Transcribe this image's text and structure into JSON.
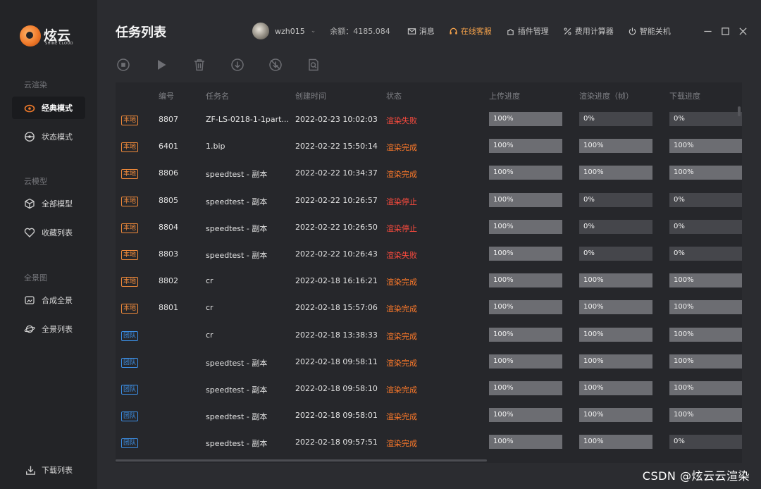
{
  "app": {
    "logo_text": "炫云",
    "logo_sub": "SHINE CLOUD"
  },
  "sidebar": {
    "groups": [
      {
        "label": "云渲染",
        "items": [
          {
            "label": "经典模式",
            "icon": "cloud-icon",
            "active": true
          },
          {
            "label": "状态模式",
            "icon": "gauge-icon",
            "active": false
          }
        ]
      },
      {
        "label": "云模型",
        "items": [
          {
            "label": "全部模型",
            "icon": "cube-icon",
            "active": false
          },
          {
            "label": "收藏列表",
            "icon": "heart-icon",
            "active": false
          }
        ]
      },
      {
        "label": "全景图",
        "items": [
          {
            "label": "合成全景",
            "icon": "panorama-icon",
            "active": false
          },
          {
            "label": "全景列表",
            "icon": "planet-icon",
            "active": false
          }
        ]
      }
    ],
    "download_label": "下载列表"
  },
  "header": {
    "title": "任务列表",
    "username": "wzh015",
    "balance": "余额：4185.084",
    "actions": [
      {
        "label": "消息",
        "icon": "mail-icon"
      },
      {
        "label": "在线客服",
        "icon": "headset-icon"
      },
      {
        "label": "插件管理",
        "icon": "plugin-icon"
      },
      {
        "label": "费用计算器",
        "icon": "percent-icon"
      },
      {
        "label": "智能关机",
        "icon": "power-icon"
      }
    ],
    "accent_color": "#f7a34b"
  },
  "toolbar": {
    "tools": [
      "stop-icon",
      "play-icon",
      "trash-icon",
      "download-icon",
      "no-download-icon",
      "inspect-icon"
    ]
  },
  "table": {
    "columns": [
      "编号",
      "任务名",
      "创建时间",
      "状态",
      "上传进度",
      "渲染进度（帧）",
      "下载进度"
    ],
    "rows": [
      {
        "tag": "本地",
        "tag_type": "local",
        "id": "8807",
        "name": "ZF-LS-0218-1-1part...",
        "created": "2022-02-23 10:02:03",
        "status": "渲染失败",
        "status_type": "fail",
        "upload": "100%",
        "render": "0%",
        "download": "0%"
      },
      {
        "tag": "本地",
        "tag_type": "local",
        "id": "6401",
        "name": "1.bip",
        "created": "2022-02-22 15:50:14",
        "status": "渲染完成",
        "status_type": "done",
        "upload": "100%",
        "render": "100%",
        "download": "100%"
      },
      {
        "tag": "本地",
        "tag_type": "local",
        "id": "8806",
        "name": "speedtest - 副本",
        "created": "2022-02-22 10:34:37",
        "status": "渲染完成",
        "status_type": "done",
        "upload": "100%",
        "render": "100%",
        "download": "100%"
      },
      {
        "tag": "本地",
        "tag_type": "local",
        "id": "8805",
        "name": "speedtest - 副本",
        "created": "2022-02-22 10:26:57",
        "status": "渲染停止",
        "status_type": "stop",
        "upload": "100%",
        "render": "0%",
        "download": "0%"
      },
      {
        "tag": "本地",
        "tag_type": "local",
        "id": "8804",
        "name": "speedtest - 副本",
        "created": "2022-02-22 10:26:50",
        "status": "渲染停止",
        "status_type": "stop",
        "upload": "100%",
        "render": "0%",
        "download": "0%"
      },
      {
        "tag": "本地",
        "tag_type": "local",
        "id": "8803",
        "name": "speedtest - 副本",
        "created": "2022-02-22 10:26:43",
        "status": "渲染失败",
        "status_type": "fail",
        "upload": "100%",
        "render": "0%",
        "download": "0%"
      },
      {
        "tag": "本地",
        "tag_type": "local",
        "id": "8802",
        "name": "cr",
        "created": "2022-02-18 16:16:21",
        "status": "渲染完成",
        "status_type": "done",
        "upload": "100%",
        "render": "100%",
        "download": "100%"
      },
      {
        "tag": "本地",
        "tag_type": "local",
        "id": "8801",
        "name": "cr",
        "created": "2022-02-18 15:57:06",
        "status": "渲染完成",
        "status_type": "done",
        "upload": "100%",
        "render": "100%",
        "download": "100%"
      },
      {
        "tag": "团队",
        "tag_type": "team",
        "id": "",
        "name": "cr",
        "created": "2022-02-18 13:38:33",
        "status": "渲染完成",
        "status_type": "done",
        "upload": "100%",
        "render": "100%",
        "download": "100%"
      },
      {
        "tag": "团队",
        "tag_type": "team",
        "id": "",
        "name": "speedtest - 副本",
        "created": "2022-02-18 09:58:11",
        "status": "渲染完成",
        "status_type": "done",
        "upload": "100%",
        "render": "100%",
        "download": "100%"
      },
      {
        "tag": "团队",
        "tag_type": "team",
        "id": "",
        "name": "speedtest - 副本",
        "created": "2022-02-18 09:58:10",
        "status": "渲染完成",
        "status_type": "done",
        "upload": "100%",
        "render": "100%",
        "download": "100%"
      },
      {
        "tag": "团队",
        "tag_type": "team",
        "id": "",
        "name": "speedtest - 副本",
        "created": "2022-02-18 09:58:01",
        "status": "渲染完成",
        "status_type": "done",
        "upload": "100%",
        "render": "100%",
        "download": "100%"
      },
      {
        "tag": "团队",
        "tag_type": "team",
        "id": "",
        "name": "speedtest - 副本",
        "created": "2022-02-18 09:57:51",
        "status": "渲染完成",
        "status_type": "done",
        "upload": "100%",
        "render": "100%",
        "download": "0%"
      }
    ]
  },
  "watermark": "CSDN @炫云云渲染"
}
